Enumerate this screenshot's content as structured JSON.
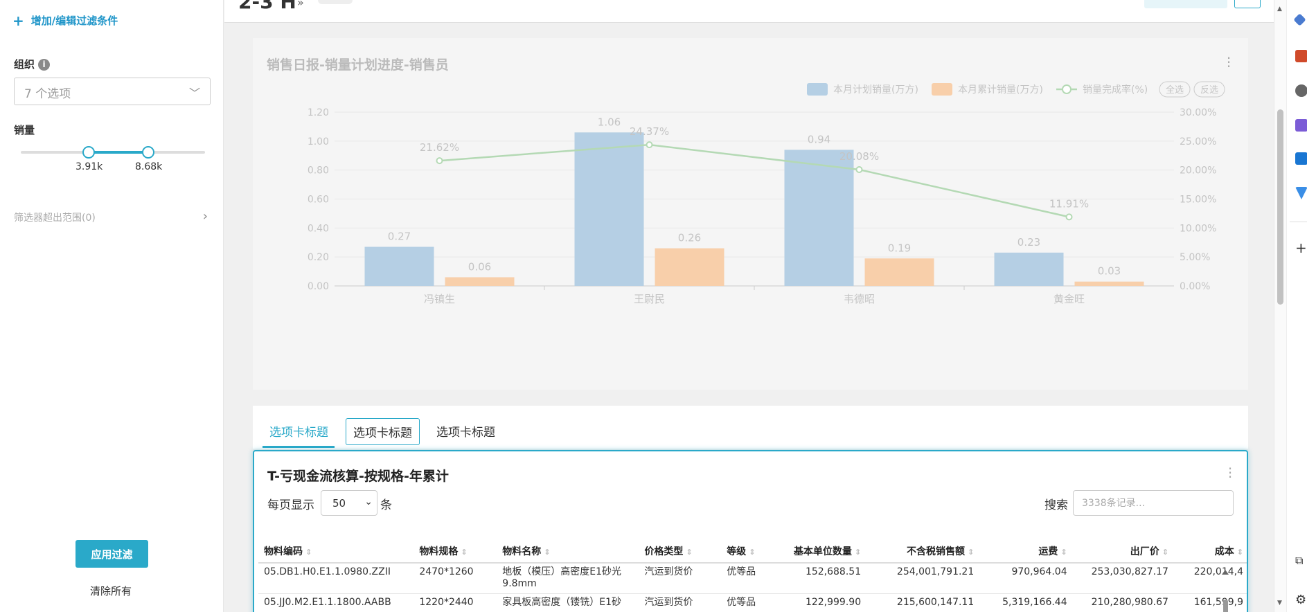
{
  "sidebar": {
    "add_filter_label": "增加/编辑过滤条件",
    "org": {
      "label": "组织",
      "info_icon": "i",
      "selected": "7 个选项",
      "chevron": "﹀"
    },
    "sales": {
      "label": "销量",
      "min": "3.91k",
      "max": "8.68k"
    },
    "out_of_range": "筛选器超出范围(0)",
    "apply_label": "应用过滤",
    "clear_label": "清除所有"
  },
  "header": {
    "title": "2-3 H",
    "arrows": "»"
  },
  "chart_data": {
    "type": "bar",
    "title": "销售日报-销量计划进度-销售员",
    "categories": [
      "冯镇生",
      "王尉民",
      "韦德昭",
      "黄金旺"
    ],
    "series": [
      {
        "name": "本月计划销量(万方)",
        "type": "bar",
        "color": "#b5cfe4",
        "values": [
          0.27,
          1.06,
          0.94,
          0.23
        ],
        "labels": [
          "0.27",
          "1.06",
          "0.94",
          "0.23"
        ]
      },
      {
        "name": "本月累计销量(万方)",
        "type": "bar",
        "color": "#f8cfaa",
        "values": [
          0.06,
          0.26,
          0.19,
          0.03
        ],
        "labels": [
          "0.06",
          "0.26",
          "0.19",
          "0.03"
        ]
      },
      {
        "name": "销量完成率(%)",
        "type": "line",
        "color": "#b4d9b4",
        "axis": "right",
        "values": [
          21.62,
          24.37,
          20.08,
          11.91
        ],
        "labels": [
          "21.62%",
          "24.37%",
          "20.08%",
          "11.91%"
        ]
      }
    ],
    "ylim_left": [
      0,
      1.2
    ],
    "ylim_right": [
      0,
      30
    ],
    "y_ticks_left": [
      "0.00",
      "0.20",
      "0.40",
      "0.60",
      "0.80",
      "1.00",
      "1.20"
    ],
    "y_ticks_right": [
      "0.00%",
      "5.00%",
      "10.00%",
      "15.00%",
      "20.00%",
      "25.00%",
      "30.00%"
    ],
    "legend_buttons": [
      "全选",
      "反选"
    ],
    "legend_position": "top-right",
    "grid": true
  },
  "tabs": [
    {
      "label": "选项卡标题"
    },
    {
      "label": "选项卡标题"
    },
    {
      "label": "选项卡标题"
    }
  ],
  "table": {
    "title": "T-亏现金流核算-按规格-年累计",
    "per_page_label": "每页显示",
    "per_page_value": "50",
    "per_page_unit": "条",
    "search_label": "搜索",
    "search_placeholder": "3338条记录...",
    "sort_icon": "⇕",
    "columns": [
      "物料编码",
      "物料规格",
      "物料名称",
      "价格类型",
      "等级",
      "基本单位数量",
      "不含税销售额",
      "运费",
      "出厂价",
      "成本"
    ],
    "rows": [
      [
        "05.DB1.H0.E1.1.0980.ZZII",
        "2470*1260",
        "地板（模压）高密度E1砂光 9.8mm",
        "汽运到货价",
        "优等品",
        "152,688.51",
        "254,001,791.21",
        "970,964.04",
        "253,030,827.17",
        "220,014,4"
      ],
      [
        "05.JJ0.M2.E1.1.1800.AABB",
        "1220*2440",
        "家具板高密度（镂铣）E1砂",
        "汽运到货价",
        "优等品",
        "122,999.90",
        "215,600,147.11",
        "5,319,166.44",
        "210,280,980.67",
        "161,599,9"
      ]
    ]
  },
  "colors": {
    "accent": "#2aa9c9",
    "bar_plan": "#b5cfe4",
    "bar_actual": "#f8cfaa",
    "line": "#b4d9b4"
  }
}
